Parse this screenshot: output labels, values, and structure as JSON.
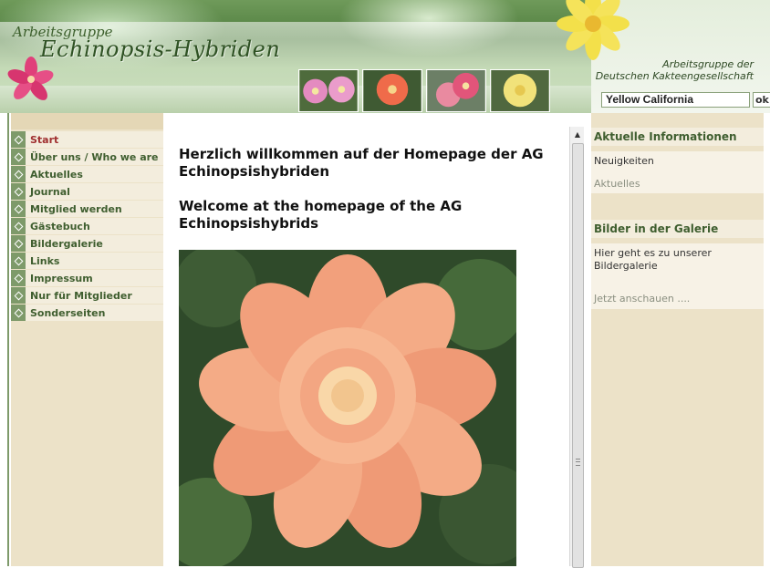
{
  "header": {
    "logo_top": "Arbeitsgruppe",
    "logo_main": "Echinopsis-Hybriden",
    "org_line1": "Arbeitsgruppe der",
    "org_line2": "Deutschen Kakteengesellschaft"
  },
  "search": {
    "value": "Yellow California",
    "button_label": "ok"
  },
  "thumbnails": [
    {
      "name": "thumbnail-pink-flowers",
      "color": "#e48bc0"
    },
    {
      "name": "thumbnail-orange-flower",
      "color": "#ef6b4a"
    },
    {
      "name": "thumbnail-pink-red-flower",
      "color": "#e2557a"
    },
    {
      "name": "thumbnail-yellow-flower",
      "color": "#f1e27a"
    }
  ],
  "menu": {
    "items": [
      {
        "label": "Start",
        "active": true
      },
      {
        "label": "Über uns / Who we are"
      },
      {
        "label": "Aktuelles"
      },
      {
        "label": "Journal"
      },
      {
        "label": "Mitglied werden"
      },
      {
        "label": "Gästebuch"
      },
      {
        "label": "Bildergalerie"
      },
      {
        "label": "Links"
      },
      {
        "label": "Impressum"
      },
      {
        "label": "Nur für Mitglieder"
      },
      {
        "label": "Sonderseiten"
      }
    ]
  },
  "main": {
    "welcome_de": "Herzlich willkommen auf der Homepage der AG Echinopsishybriden",
    "welcome_en": "Welcome at the homepage of the AG Echinopsishybrids"
  },
  "right": {
    "box1": {
      "title": "Aktuelle Informationen",
      "text": "Neuigkeiten",
      "link": "Aktuelles"
    },
    "box2": {
      "title": "Bilder in der Galerie",
      "text": "Hier geht es zu unserer Bildergalerie",
      "link": "Jetzt anschauen ...."
    }
  },
  "colors": {
    "accent_green": "#3f5e2f",
    "active_menu": "#a03030",
    "sidebar_bg": "#ece2c8"
  }
}
